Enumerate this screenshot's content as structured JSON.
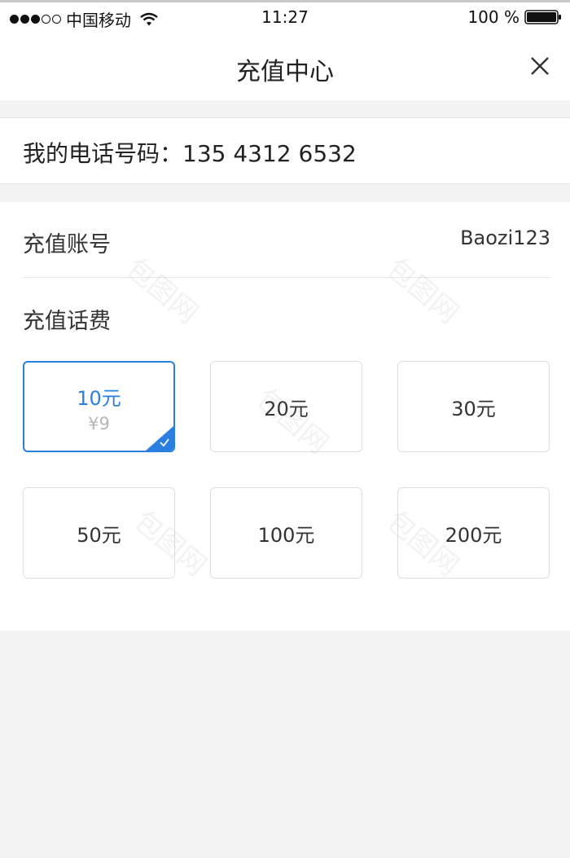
{
  "status_bar": {
    "carrier": "中国移动",
    "time": "11:27",
    "battery": "100 %",
    "icons": [
      "signal-dots-icon",
      "wifi-icon",
      "battery-icon"
    ]
  },
  "nav": {
    "title": "充值中心",
    "close_icon": "close-icon"
  },
  "phone": {
    "label": "我的电话号码：",
    "number": "135 4312 6532"
  },
  "account": {
    "label": "充值账号",
    "value": "Baozi123"
  },
  "recharge": {
    "label": "充值话费",
    "options": [
      {
        "amount": "10元",
        "price": "¥9",
        "selected": true
      },
      {
        "amount": "20元",
        "selected": false
      },
      {
        "amount": "30元",
        "selected": false
      },
      {
        "amount": "50元",
        "selected": false
      },
      {
        "amount": "100元",
        "selected": false
      },
      {
        "amount": "200元",
        "selected": false
      }
    ]
  },
  "colors": {
    "accent": "#2a7fe0",
    "background": "#f3f3f3",
    "card": "#ffffff",
    "muted_text": "#b5b5b5"
  },
  "watermark": "包图网"
}
